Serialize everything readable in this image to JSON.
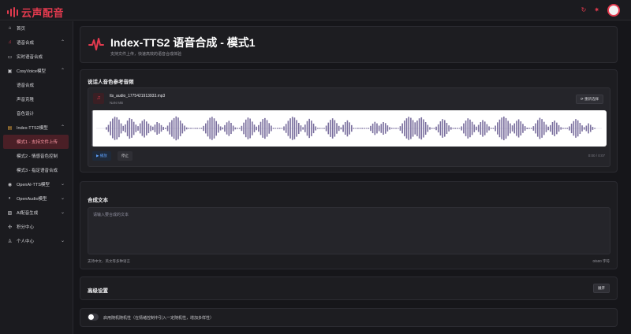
{
  "app": {
    "logo_text": "云声配音"
  },
  "sidebar": {
    "items": [
      {
        "label": "首页",
        "icon": "home-icon",
        "glyph": "⌂"
      },
      {
        "label": "语音合成",
        "icon": "music-icon",
        "glyph": "♫",
        "chevron": "⌃"
      },
      {
        "label": "实时语音合成",
        "icon": "screen-icon",
        "glyph": "▭"
      },
      {
        "label": "CosyVoice模型",
        "icon": "box-icon",
        "glyph": "▣",
        "chevron": "⌃"
      },
      {
        "label": "语音合成",
        "sub": true
      },
      {
        "label": "声音克隆",
        "sub": true
      },
      {
        "label": "音色设计",
        "sub": true
      },
      {
        "label": "Index-TTS2模型",
        "icon": "folder-icon",
        "glyph": "▤",
        "chevron": "⌃"
      },
      {
        "label": "模式1 - 支持文件上传",
        "sub": true,
        "active": true
      },
      {
        "label": "模式2 - 情感音色控制",
        "sub": true
      },
      {
        "label": "模式3 - 指定语音合成",
        "sub": true
      },
      {
        "label": "OpenAI-TTS模型",
        "icon": "cloud-icon",
        "glyph": "◉",
        "chevron": "⌄"
      },
      {
        "label": "OpenAudio模型",
        "icon": "headphones-icon",
        "glyph": "◐",
        "chevron": "⌄"
      },
      {
        "label": "AI配音生成",
        "icon": "image-icon",
        "glyph": "▨",
        "chevron": "⌄"
      },
      {
        "label": "积分中心",
        "icon": "gift-icon",
        "glyph": "✣"
      },
      {
        "label": "个人中心",
        "icon": "user-icon",
        "glyph": "♙",
        "chevron": "⌄"
      }
    ]
  },
  "header": {
    "title": "Index-TTS2 语音合成 - 模式1",
    "subtitle": "支持文件上传，快速高效的语音合成体验"
  },
  "voice": {
    "section_title": "说话人音色参考音频",
    "file_name": "tts_audio_1775421913933.mp3",
    "file_size": "NaN MB",
    "reselect_label": "重新选择",
    "play_label": "播放",
    "stop_label": "停止",
    "time": "0:00 / 0:07"
  },
  "text": {
    "section_title": "合成文本",
    "placeholder": "请输入要合成的文本",
    "hint": "支持中文、英文等多种语言",
    "count": "0/500 字符"
  },
  "advanced": {
    "section_title": "高级设置",
    "expand_label": "展开"
  },
  "random": {
    "label": "启用随机随机性（在情绪控制中引入一定随机性，增加多样性）"
  },
  "colors": {
    "accent": "#e23a4e",
    "background": "#16161a",
    "panel": "#1d1d21",
    "waveform": "#7a6f9e"
  },
  "waveform": {
    "amplitudes": [
      0.1,
      0.28,
      0.55,
      0.78,
      0.92,
      0.88,
      0.7,
      0.4,
      0.2,
      0.32,
      0.62,
      0.82,
      0.74,
      0.52,
      0.3,
      0.18,
      0.4,
      0.6,
      0.72,
      0.55,
      0.38,
      0.22,
      0.14,
      0.3,
      0.5,
      0.42,
      0.26,
      0.12,
      0.05,
      0.22,
      0.48,
      0.66,
      0.82,
      0.95,
      0.86,
      0.62,
      0.4,
      0.22,
      0.08,
      0.04,
      0.04,
      0.03,
      0.04,
      0.04,
      0.03,
      0.04,
      0.2,
      0.4,
      0.64,
      0.84,
      0.92,
      0.8,
      0.58,
      0.34,
      0.16,
      0.08,
      0.26,
      0.48,
      0.6,
      0.44,
      0.22,
      0.08,
      0.04,
      0.04,
      0.2,
      0.46,
      0.7,
      0.86,
      0.78,
      0.54,
      0.3,
      0.14,
      0.26,
      0.52,
      0.74,
      0.82,
      0.66,
      0.42,
      0.22,
      0.04,
      0.03,
      0.04,
      0.04,
      0.03,
      0.16,
      0.36,
      0.6,
      0.8,
      0.92,
      0.86,
      0.66,
      0.44,
      0.24,
      0.1,
      0.3,
      0.58,
      0.76,
      0.62,
      0.38,
      0.16,
      0.04,
      0.04,
      0.03,
      0.04,
      0.22,
      0.46,
      0.68,
      0.8,
      0.66,
      0.42,
      0.2,
      0.08,
      0.28,
      0.5,
      0.64,
      0.48,
      0.26,
      0.04,
      0.03,
      0.04,
      0.04,
      0.04,
      0.04,
      0.03,
      0.04,
      0.2,
      0.38,
      0.52,
      0.4,
      0.22,
      0.36,
      0.5,
      0.42,
      0.24,
      0.1,
      0.04,
      0.04,
      0.04,
      0.03,
      0.18,
      0.4,
      0.62,
      0.8,
      0.92,
      0.84,
      0.66,
      0.48,
      0.62,
      0.8,
      0.88,
      0.72,
      0.5,
      0.28,
      0.1,
      0.04,
      0.04,
      0.14,
      0.32,
      0.56,
      0.74,
      0.66,
      0.44,
      0.24,
      0.1,
      0.04,
      0.04,
      0.04,
      0.03,
      0.16,
      0.4,
      0.62,
      0.8,
      0.7,
      0.52,
      0.3,
      0.14,
      0.28,
      0.5,
      0.66,
      0.54,
      0.34,
      0.16,
      0.04,
      0.04,
      0.22,
      0.48,
      0.7,
      0.86,
      0.94,
      0.82,
      0.6,
      0.4,
      0.24,
      0.4,
      0.6,
      0.72,
      0.56,
      0.36,
      0.18,
      0.06,
      0.04,
      0.04,
      0.18,
      0.4,
      0.66,
      0.84,
      0.74,
      0.52,
      0.3,
      0.14,
      0.26,
      0.5,
      0.62,
      0.46,
      0.26,
      0.1,
      0.04,
      0.04,
      0.04,
      0.16,
      0.38,
      0.58,
      0.74,
      0.64,
      0.44,
      0.24,
      0.1,
      0.22,
      0.4,
      0.28,
      0.12,
      0.04
    ]
  }
}
